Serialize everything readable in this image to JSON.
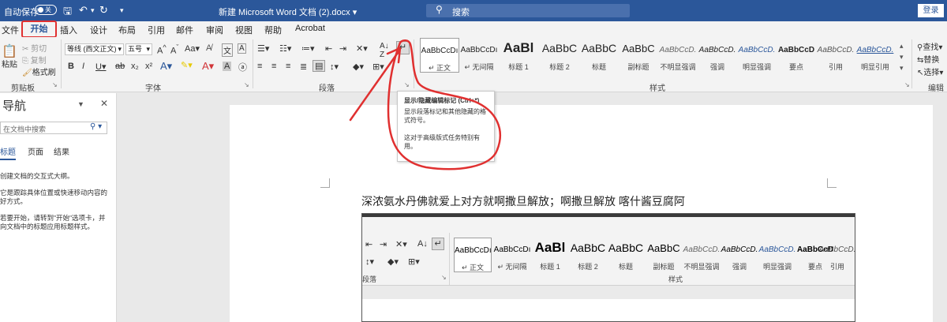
{
  "titlebar": {
    "autosave_label": "自动保存",
    "autosave_state": "关",
    "doc_title": "新建 Microsoft Word 文档 (2).docx",
    "search_placeholder": "搜索",
    "login_label": "登录"
  },
  "tabs": [
    "文件",
    "开始",
    "插入",
    "设计",
    "布局",
    "引用",
    "邮件",
    "审阅",
    "视图",
    "帮助",
    "Acrobat"
  ],
  "ribbon": {
    "clipboard": {
      "paste": "粘贴",
      "cut": "剪切",
      "copy": "复制",
      "format_painter": "格式刷",
      "group": "剪贴板"
    },
    "font": {
      "font_name": "等线 (西文正文)",
      "font_size": "五号",
      "group": "字体"
    },
    "paragraph": {
      "group": "段落"
    },
    "styles": {
      "group": "样式",
      "items": [
        {
          "sample": "AaBbCcDı",
          "name": "↵ 正文"
        },
        {
          "sample": "AaBbCcDı",
          "name": "↵ 无间隔"
        },
        {
          "sample": "AaBl",
          "name": "标题 1"
        },
        {
          "sample": "AaBbC",
          "name": "标题 2"
        },
        {
          "sample": "AaBbC",
          "name": "标题"
        },
        {
          "sample": "AaBbC",
          "name": "副标题"
        },
        {
          "sample": "AaBbCcD.",
          "name": "不明显强调"
        },
        {
          "sample": "AaBbCcD.",
          "name": "强调"
        },
        {
          "sample": "AaBbCcD.",
          "name": "明显强调"
        },
        {
          "sample": "AaBbCcD",
          "name": "要点"
        },
        {
          "sample": "AaBbCcD.",
          "name": "引用"
        },
        {
          "sample": "AaBbCcD.",
          "name": "明显引用"
        }
      ]
    },
    "editing": {
      "find": "查找",
      "replace": "替换",
      "select": "选择",
      "group": "编辑"
    }
  },
  "tooltip": {
    "title": "显示/隐藏编辑标记 (Ctrl+*)",
    "line1": "显示段落标记和其他隐藏的格式符号。",
    "line2": "这对于高级版式任务特别有用。"
  },
  "navpane": {
    "title": "导航",
    "search_placeholder": "在文档中搜索",
    "tabs": [
      "标题",
      "页面",
      "结果"
    ],
    "text1": "创建文档的交互式大纲。",
    "text2": "它是跟踪具体位置或快速移动内容的好方式。",
    "text3": "若要开始，请转到\"开始\"选项卡，并向文档中的标题应用标题样式。"
  },
  "document": {
    "body_text": "深浓氨水丹佛就爱上对方就啊撒旦解放；啊撒旦解放  喀什酱豆腐阿"
  },
  "embedded": {
    "styles": [
      {
        "sample": "AaBbCcDı",
        "name": "↵ 正文"
      },
      {
        "sample": "AaBbCcDı",
        "name": "↵ 无间隔"
      },
      {
        "sample": "AaBl",
        "name": "标题 1"
      },
      {
        "sample": "AaBbC",
        "name": "标题 2"
      },
      {
        "sample": "AaBbC",
        "name": "标题"
      },
      {
        "sample": "AaBbC",
        "name": "副标题"
      },
      {
        "sample": "AaBbCcD.",
        "name": "不明显强调"
      },
      {
        "sample": "AaBbCcD.",
        "name": "强调"
      },
      {
        "sample": "AaBbCcD.",
        "name": "明显强调"
      },
      {
        "sample": "AaBbCcD",
        "name": "要点"
      },
      {
        "sample": "AaBbCcD.",
        "name": "引用"
      }
    ],
    "paragraph_group": "段落",
    "styles_group": "样式"
  },
  "colors": {
    "word_blue": "#2b579a",
    "annotation_red": "#e03030"
  }
}
